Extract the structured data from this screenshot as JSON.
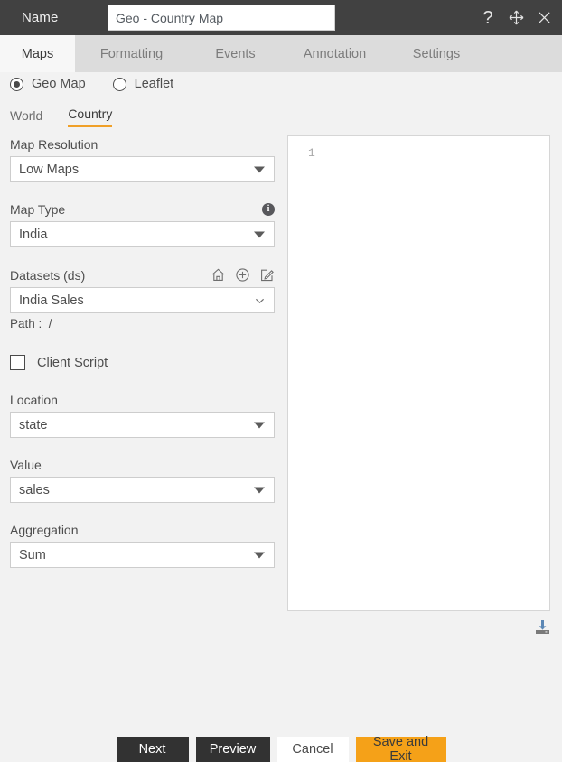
{
  "titlebar": {
    "label": "Name",
    "name_value": "Geo - Country Map",
    "name_placeholder": "Name",
    "help_icon": "question-mark-icon",
    "move_icon": "move-icon",
    "close_icon": "close-icon"
  },
  "tabs": [
    {
      "label": "Maps",
      "active": true
    },
    {
      "label": "Formatting",
      "active": false
    },
    {
      "label": "Events",
      "active": false
    },
    {
      "label": "Annotation",
      "active": false
    },
    {
      "label": "Settings",
      "active": false
    }
  ],
  "map_mode": {
    "options": [
      {
        "label": "Geo Map",
        "selected": true
      },
      {
        "label": "Leaflet",
        "selected": false
      }
    ]
  },
  "scope_tabs": [
    {
      "label": "World",
      "active": false
    },
    {
      "label": "Country",
      "active": true
    }
  ],
  "fields": {
    "map_resolution": {
      "label": "Map Resolution",
      "value": "Low Maps"
    },
    "map_type": {
      "label": "Map Type",
      "value": "India",
      "info_icon": "info-icon"
    },
    "datasets": {
      "label": "Datasets (ds)",
      "value": "India Sales",
      "icons": [
        "home-icon",
        "plus-circle-icon",
        "edit-icon"
      ],
      "path_label": "Path :",
      "path_value": "/"
    },
    "client_script": {
      "label": "Client Script",
      "checked": false
    },
    "location": {
      "label": "Location",
      "value": "state"
    },
    "value": {
      "label": "Value",
      "value": "sales"
    },
    "aggregation": {
      "label": "Aggregation",
      "value": "Sum"
    }
  },
  "editor": {
    "line_number": "1",
    "content": "",
    "download_icon": "download-icon"
  },
  "footer": {
    "next": "Next",
    "preview": "Preview",
    "cancel": "Cancel",
    "save_and_exit": "Save and Exit"
  },
  "colors": {
    "titlebar_bg": "#414141",
    "tabbar_bg": "#dcdcdc",
    "accent": "#f5a118",
    "active_underline": "#f0a028",
    "page_bg": "#f2f2f2",
    "button_dark": "#323232"
  }
}
